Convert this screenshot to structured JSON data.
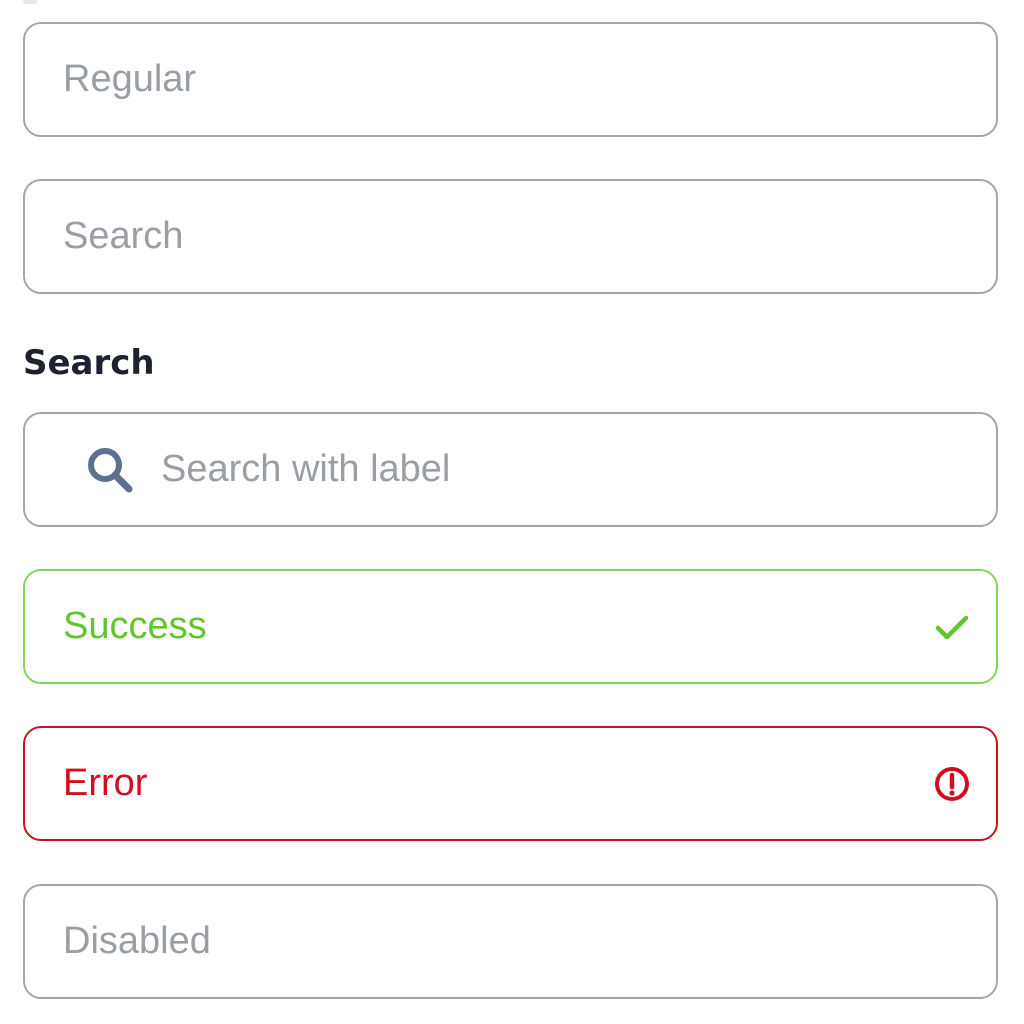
{
  "fields": {
    "regular": {
      "placeholder": "Regular"
    },
    "search": {
      "placeholder": "Search"
    },
    "search_with_label": {
      "label": "Search",
      "placeholder": "Search with label",
      "icon": "search-icon"
    },
    "success": {
      "value": "Success",
      "icon": "check-icon"
    },
    "error": {
      "value": "Error",
      "icon": "alert-circle-icon"
    },
    "disabled": {
      "placeholder": "Disabled"
    }
  },
  "colors": {
    "border_default": "#a3a6ab",
    "placeholder": "#9a9ea5",
    "label": "#1c2230",
    "search_icon": "#5f6f8e",
    "success": "#5ec72f",
    "success_border": "#7ed957",
    "error": "#d0101e"
  }
}
